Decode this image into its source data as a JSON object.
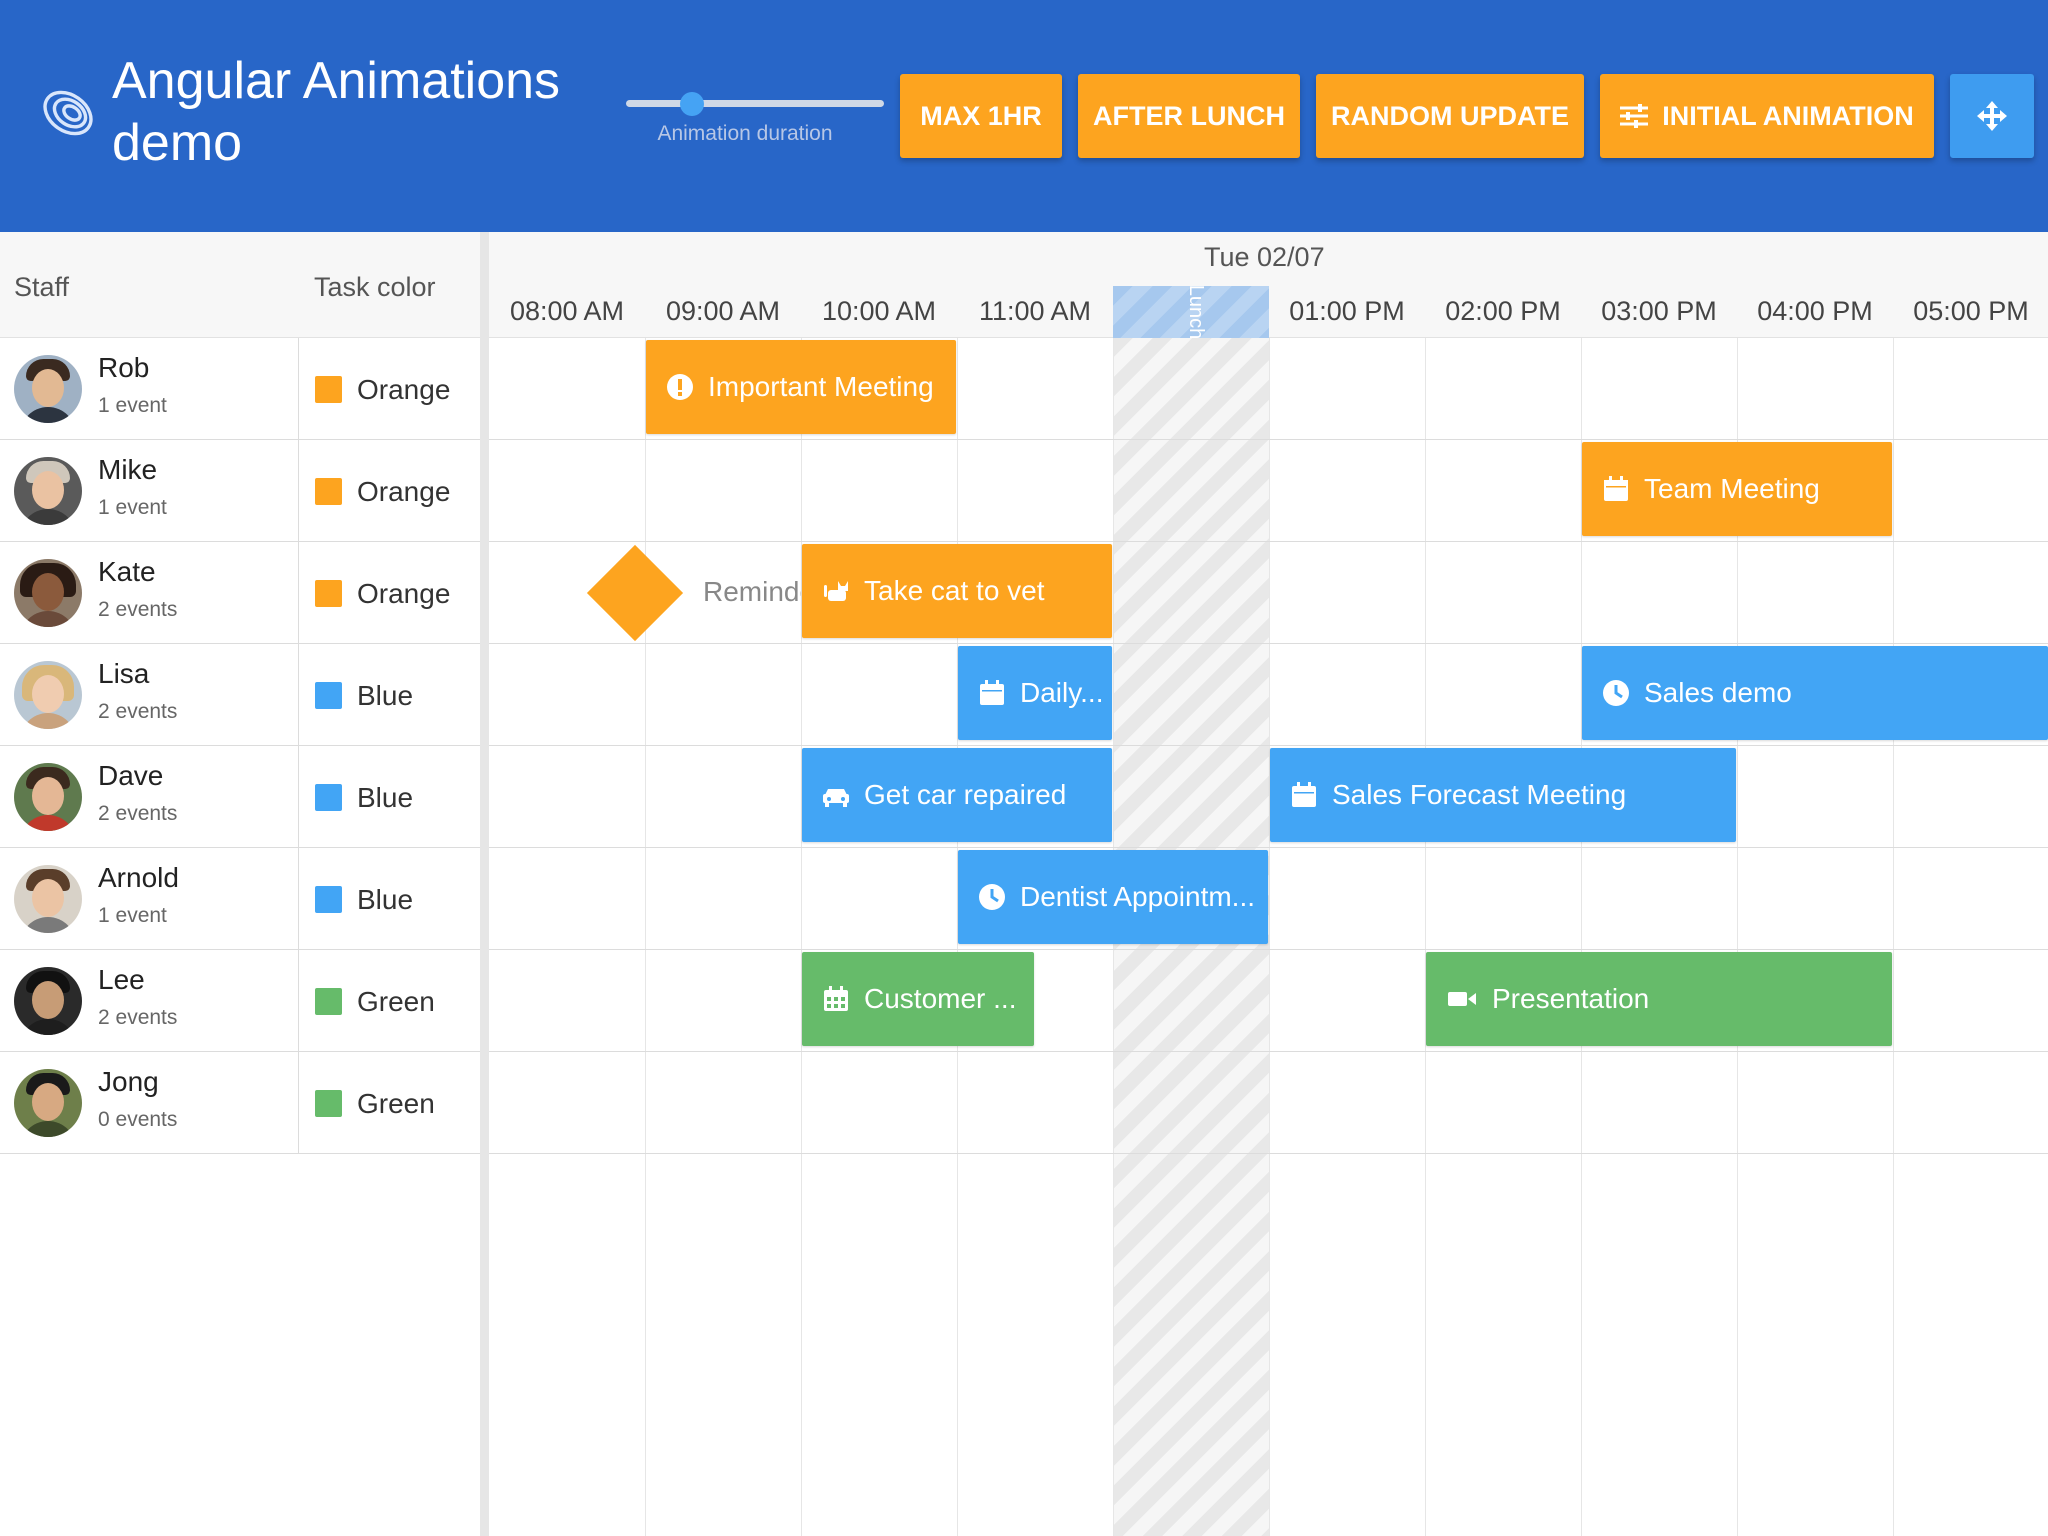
{
  "header": {
    "title": "Angular Animations demo",
    "slider_label": "Animation duration",
    "slider_value": 0.23,
    "buttons": {
      "max_1hr": "MAX 1HR",
      "after_lunch": "AFTER LUNCH",
      "random_update": "RANDOM UPDATE",
      "initial_animation": "INITIAL ANIMATION"
    },
    "logo_icon": "spiral-logo-icon",
    "fit_icon": "move-arrows-icon",
    "tune_icon": "tune-icon"
  },
  "left": {
    "col_staff": "Staff",
    "col_color": "Task color",
    "staff": [
      {
        "name": "Rob",
        "events": "1 event",
        "color": "Orange"
      },
      {
        "name": "Mike",
        "events": "1 event",
        "color": "Orange"
      },
      {
        "name": "Kate",
        "events": "2 events",
        "color": "Orange"
      },
      {
        "name": "Lisa",
        "events": "2 events",
        "color": "Blue"
      },
      {
        "name": "Dave",
        "events": "2 events",
        "color": "Blue"
      },
      {
        "name": "Arnold",
        "events": "1 event",
        "color": "Blue"
      },
      {
        "name": "Lee",
        "events": "2 events",
        "color": "Green"
      },
      {
        "name": "Jong",
        "events": "0 events",
        "color": "Green"
      }
    ]
  },
  "schedule": {
    "date": "Tue 02/07",
    "hours": [
      "08:00 AM",
      "09:00 AM",
      "10:00 AM",
      "11:00 AM",
      "",
      "01:00 PM",
      "02:00 PM",
      "03:00 PM",
      "04:00 PM",
      "05:00 PM"
    ],
    "lunch_label": "Lunch",
    "events": [
      {
        "label": "Important Meeting",
        "icon": "exclamation-circle-icon"
      },
      {
        "label": "Team Meeting",
        "icon": "calendar-icon"
      },
      {
        "label": "Take cat to vet",
        "icon": "cat-icon"
      },
      {
        "label": "Daily...",
        "icon": "calendar-icon"
      },
      {
        "label": "Sales demo",
        "icon": "clock-icon"
      },
      {
        "label": "Get car repaired",
        "icon": "car-icon"
      },
      {
        "label": "Sales Forecast Meeting",
        "icon": "calendar-icon"
      },
      {
        "label": "Dentist Appointm...",
        "icon": "clock-icon"
      },
      {
        "label": "Customer ...",
        "icon": "calendar-grid-icon"
      },
      {
        "label": "Presentation",
        "icon": "video-icon"
      }
    ],
    "milestone_label": "Reminder"
  },
  "colors": {
    "header_bg": "#2866c8",
    "orange": "#fda41f",
    "blue": "#42a5f5",
    "green": "#66bb6a",
    "accent_button": "#3e9cf0"
  }
}
